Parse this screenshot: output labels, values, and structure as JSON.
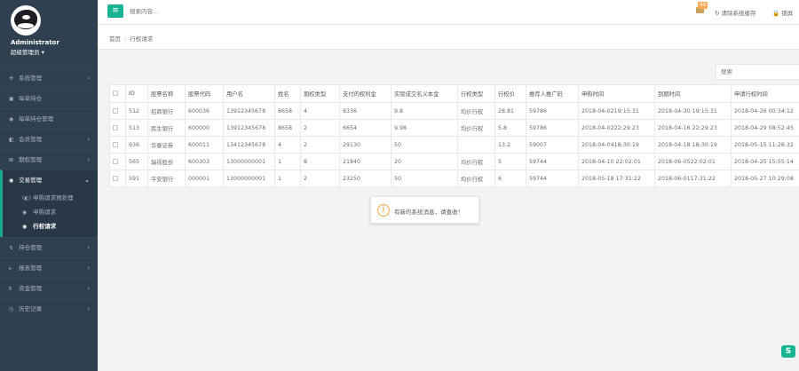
{
  "profile": {
    "name": "Administrator",
    "role": "超级管理员 ▾"
  },
  "sidebar": {
    "items": [
      {
        "icon": "✣",
        "label": "系统管理",
        "arrow": "‹"
      },
      {
        "icon": "▣",
        "label": "每单持仓",
        "arrow": ""
      },
      {
        "icon": "◉",
        "label": "每单持仓管理",
        "arrow": ""
      },
      {
        "icon": "◧",
        "label": "会员管理",
        "arrow": "‹"
      },
      {
        "icon": "⊠",
        "label": "期权管理",
        "arrow": "‹"
      }
    ],
    "active": {
      "icon": "◉",
      "label": "交易管理",
      "arrow": "⌄"
    },
    "sub": [
      {
        "icon": "(◐)",
        "label": "申购请求预处理"
      },
      {
        "icon": "◉",
        "label": "申购请求"
      },
      {
        "icon": "◉",
        "label": "行权请求"
      }
    ],
    "after": [
      {
        "icon": "↯",
        "label": "持仓管理",
        "arrow": "‹"
      },
      {
        "icon": "⫸",
        "label": "报表管理",
        "arrow": "‹"
      },
      {
        "icon": "Ⅱ",
        "label": "资金管理",
        "arrow": "‹"
      },
      {
        "icon": "◷",
        "label": "历史记录",
        "arrow": "‹"
      }
    ]
  },
  "topbar": {
    "menu_icon": "≡",
    "search_placeholder": "搜索内容...",
    "mail_badge": "49",
    "refresh_label": "↻ 清除系统缓存",
    "lock_label": "🔒 锁屏"
  },
  "breadcrumb": {
    "home": "首页",
    "current": "行权请求"
  },
  "table": {
    "search_placeholder": "搜索",
    "headers": [
      "",
      "ID",
      "股票名称",
      "股票代码",
      "用户名",
      "姓名",
      "期权类型",
      "支付的权利金",
      "实际成交名义本金",
      "行权类型",
      "行权价",
      "推荐人推广码",
      "申购时间",
      "到期时间",
      "申请行权时间"
    ],
    "rows": [
      [
        "512",
        "招商银行",
        "600036",
        "13912345678",
        "8658",
        "4",
        "8336",
        "9.8",
        "均价行权",
        "28.81",
        "59786",
        "2018-04-0219:15:31",
        "2018-04-30 19:15:31",
        "2018-04-26 00:34:12"
      ],
      [
        "513",
        "民生银行",
        "600000",
        "13912345678",
        "8658",
        "2",
        "6654",
        "9.98",
        "均价行权",
        "5.8",
        "59786",
        "2018-04-0222:29:23",
        "2018-04-16 22:29:23",
        "2018-04-29 08:52:45"
      ],
      [
        "936",
        "华泰证券",
        "600011",
        "13412345678",
        "4",
        "2",
        "29130",
        "50",
        "",
        "13.2",
        "59007",
        "2018-04-0418:30:19",
        "2018-04-18 18:30:19",
        "2018-05-15 11:28:32"
      ],
      [
        "565",
        "瑞视股份",
        "600303",
        "13000000001",
        "1",
        "8",
        "21840",
        "20",
        "均价行权",
        "5",
        "59744",
        "2018-04-10 22:02:01",
        "2018-06-0522:02:01",
        "2018-04-25 15:55:14"
      ],
      [
        "591",
        "平安银行",
        "000001",
        "13000000001",
        "1",
        "2",
        "23250",
        "50",
        "均价行权",
        "6",
        "59744",
        "2018-05-18 17:31:22",
        "2018-06-0117:31:22",
        "2018-05-27 10:29:08"
      ]
    ]
  },
  "toast": {
    "icon": "!",
    "message": "有新的系统消息，请查收！"
  },
  "corner": {
    "glyph": "S"
  }
}
